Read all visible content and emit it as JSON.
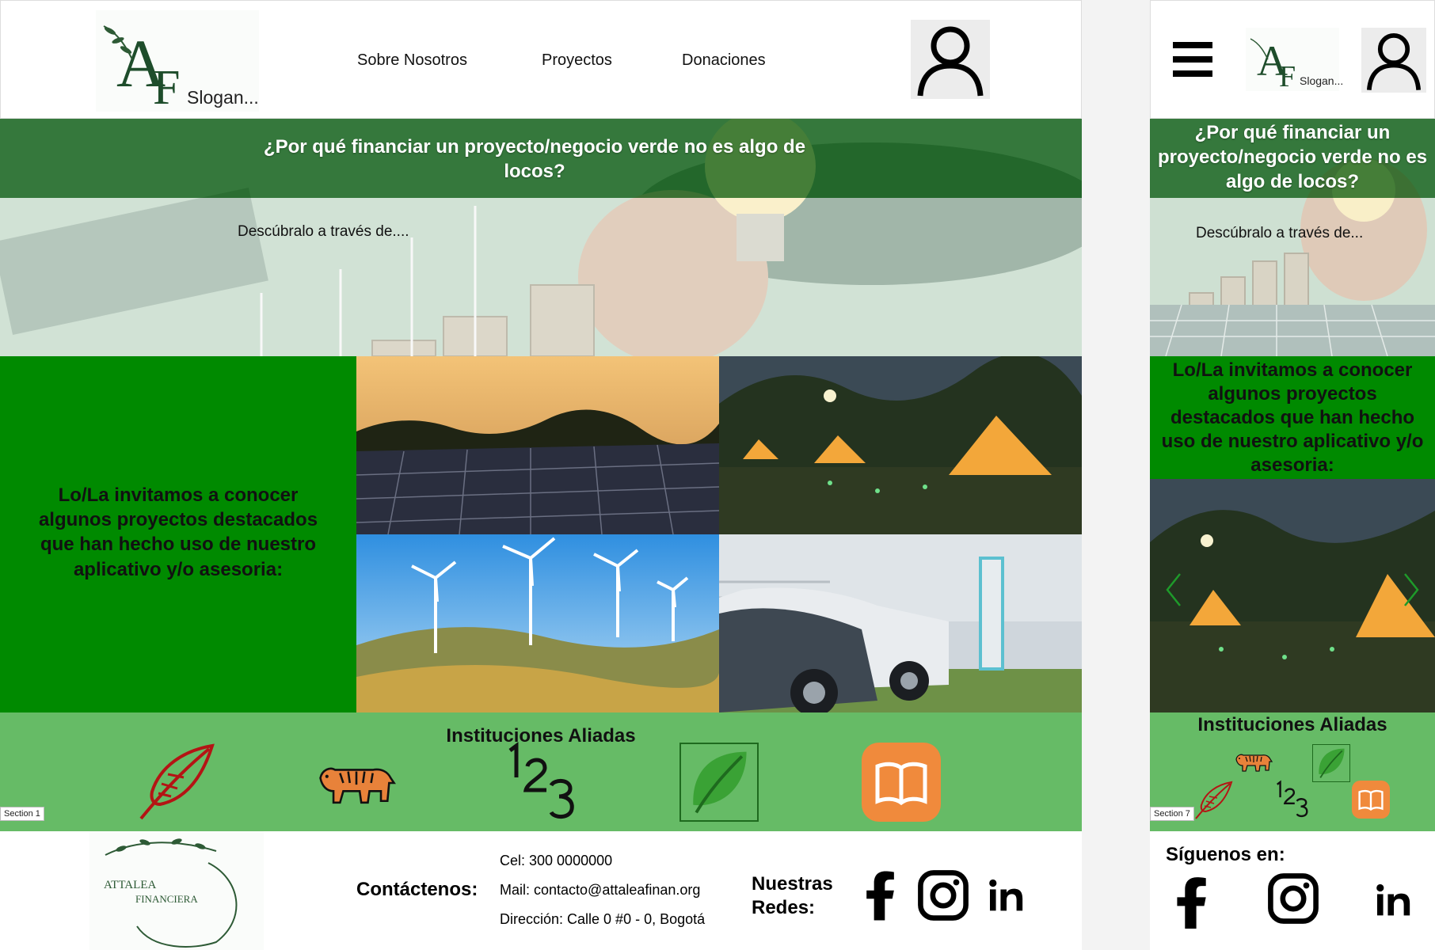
{
  "header": {
    "slogan": "Slogan...",
    "logo_letters": "AF",
    "nav": [
      {
        "label": "Sobre Nosotros"
      },
      {
        "label": "Proyectos"
      },
      {
        "label": "Donaciones"
      }
    ],
    "user_icon": "user-icon",
    "menu_icon": "hamburger-menu-icon"
  },
  "hero": {
    "title": "¿Por qué financiar un proyecto/negocio verde no es algo de locos?",
    "subtitle": "Descúbralo a través de....",
    "mobile_subtitle": "Descúbralo a través de..."
  },
  "projects": {
    "title": "Lo/La invitamos a conocer algunos proyectos destacados que han hecho uso de nuestro aplicativo y/o asesoria:",
    "images": [
      "solar-panels",
      "glamping-tents",
      "wind-turbines",
      "electric-cars-charging"
    ]
  },
  "allies": {
    "title": "Instituciones Aliadas",
    "icons": [
      "feather-icon",
      "tiger-icon",
      "numbers-123-icon",
      "leaf-icon",
      "book-icon"
    ],
    "section_label_desktop": "Section 1",
    "section_label_mobile": "Section 7"
  },
  "footer": {
    "brand_line1": "ATTALEA",
    "brand_line2": "FINANCIERA",
    "contact_label": "Contáctenos:",
    "phone": "Cel: 300 0000000",
    "mail": "Mail: contacto@attaleafinan.org",
    "address": "Dirección: Calle 0 #0 - 0, Bogotá",
    "social_label": "Nuestras Redes:",
    "mobile_social_label": "Síguenos en:",
    "social_icons": [
      "facebook-icon",
      "instagram-icon",
      "linkedin-icon"
    ]
  },
  "colors": {
    "brand_green": "#008a00",
    "allies_green": "#66bb66",
    "dark_green": "#1e4d2b",
    "book_orange": "#f08a3c"
  }
}
